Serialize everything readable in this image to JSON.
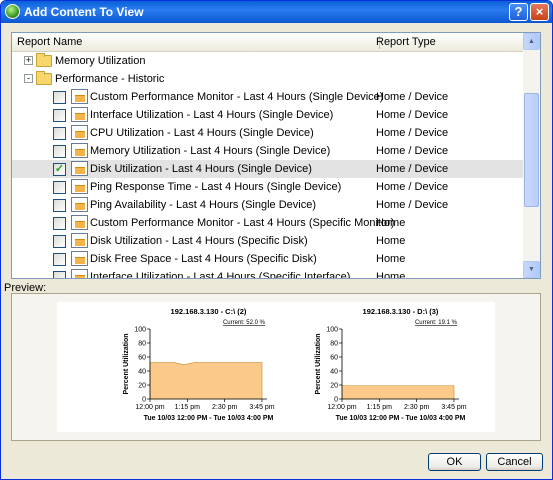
{
  "window": {
    "title": "Add Content To View",
    "help_label": "?",
    "close_label": "×"
  },
  "list": {
    "header": {
      "name": "Report Name",
      "type": "Report Type"
    },
    "rows": [
      {
        "kind": "folder",
        "expander": "+",
        "name": "Memory Utilization",
        "type": ""
      },
      {
        "kind": "folder",
        "expander": "-",
        "name": "Performance - Historic",
        "type": ""
      },
      {
        "kind": "report",
        "checked": false,
        "name": "Custom Performance Monitor - Last 4 Hours (Single Device)",
        "type": "Home / Device"
      },
      {
        "kind": "report",
        "checked": false,
        "name": "Interface Utilization - Last 4 Hours (Single Device)",
        "type": "Home / Device"
      },
      {
        "kind": "report",
        "checked": false,
        "name": "CPU Utilization - Last 4 Hours (Single Device)",
        "type": "Home / Device"
      },
      {
        "kind": "report",
        "checked": false,
        "name": "Memory Utilization - Last 4 Hours (Single Device)",
        "type": "Home / Device"
      },
      {
        "kind": "report",
        "checked": true,
        "name": "Disk Utilization - Last 4 Hours (Single Device)",
        "type": "Home / Device"
      },
      {
        "kind": "report",
        "checked": false,
        "name": "Ping Response Time - Last 4 Hours (Single Device)",
        "type": "Home / Device"
      },
      {
        "kind": "report",
        "checked": false,
        "name": "Ping Availability - Last 4 Hours (Single Device)",
        "type": "Home / Device"
      },
      {
        "kind": "report",
        "checked": false,
        "name": "Custom Performance Monitor - Last 4 Hours (Specific Monitor)",
        "type": "Home"
      },
      {
        "kind": "report",
        "checked": false,
        "name": "Disk Utilization - Last 4 Hours (Specific Disk)",
        "type": "Home"
      },
      {
        "kind": "report",
        "checked": false,
        "name": "Disk Free Space - Last 4 Hours (Specific Disk)",
        "type": "Home"
      },
      {
        "kind": "report",
        "checked": false,
        "name": "Interface Utilization - Last 4 Hours (Specific Interface)",
        "type": "Home"
      }
    ]
  },
  "preview": {
    "label": "Preview:"
  },
  "chart_data": [
    {
      "type": "area",
      "title": "192.168.3.130 - C:\\ (2)",
      "current": "Current: 52.0 %",
      "ylabel": "Percent Utilization",
      "xlabel": "Tue 10/03 12:00 PM - Tue 10/03 4:00 PM",
      "ylim": [
        0,
        100
      ],
      "yticks": [
        "0",
        "20",
        "40",
        "60",
        "80",
        "100"
      ],
      "xticks": [
        "12:00 pm",
        "1:15 pm",
        "2:30 pm",
        "3:45 pm"
      ],
      "series": [
        {
          "x": [
            0,
            0.22,
            0.3,
            0.4,
            1
          ],
          "values": [
            52,
            52,
            49,
            52,
            52
          ]
        }
      ],
      "fill": "#fbc98a"
    },
    {
      "type": "area",
      "title": "192.168.3.130 - D:\\ (3)",
      "current": "Current: 19.1 %",
      "ylabel": "Percent Utilization",
      "xlabel": "Tue 10/03 12:00 PM - Tue 10/03 4:00 PM",
      "ylim": [
        0,
        100
      ],
      "yticks": [
        "0",
        "20",
        "40",
        "60",
        "80",
        "100"
      ],
      "xticks": [
        "12:00 pm",
        "1:15 pm",
        "2:30 pm",
        "3:45 pm"
      ],
      "series": [
        {
          "x": [
            0,
            1
          ],
          "values": [
            19.1,
            19.1
          ]
        }
      ],
      "fill": "#fbc98a"
    }
  ],
  "buttons": {
    "ok": "OK",
    "cancel": "Cancel"
  }
}
